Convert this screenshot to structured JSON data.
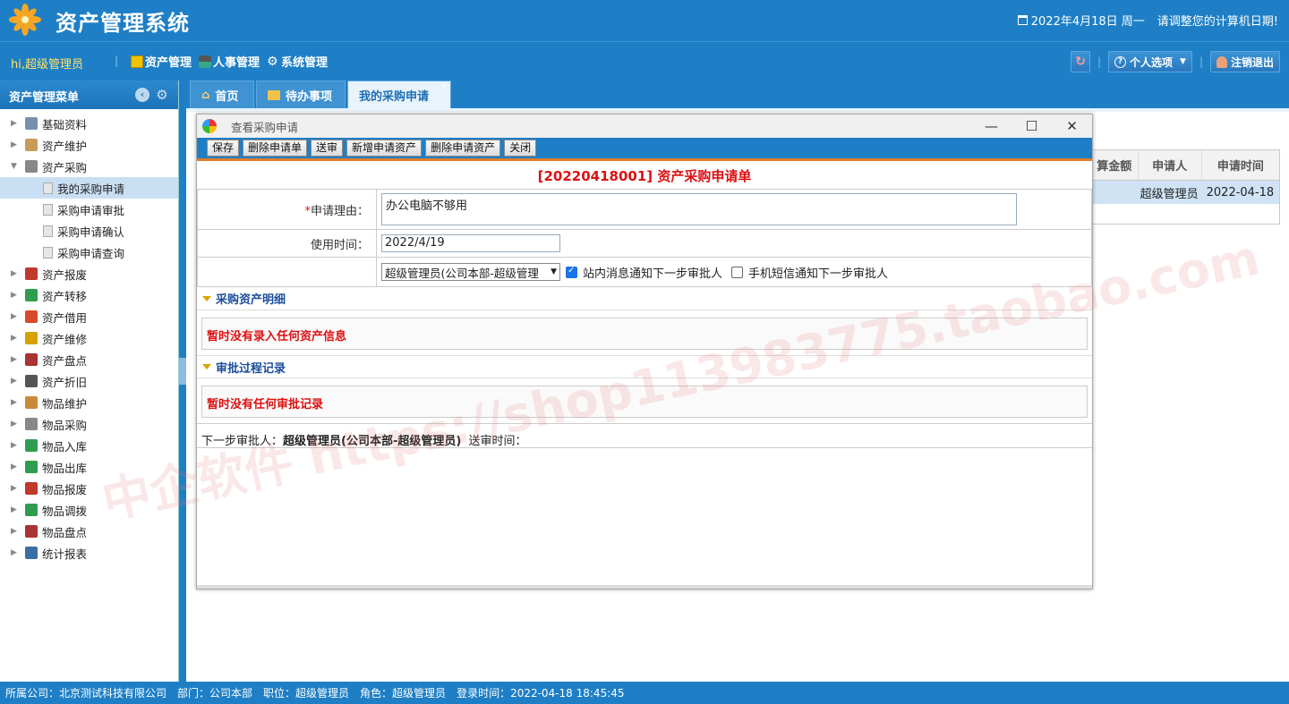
{
  "header": {
    "title": "资产管理系统",
    "date_text": "2022年4月18日 周一",
    "date_notice": "请调整您的计算机日期!"
  },
  "menubar": {
    "greeting": "hi,超级管理员",
    "items": [
      {
        "label": "资产管理",
        "icon": "notebook-icon"
      },
      {
        "label": "人事管理",
        "icon": "people-icon"
      },
      {
        "label": "系统管理",
        "icon": "gear-icon"
      }
    ],
    "personal_options": "个人选项",
    "logout": "注销退出"
  },
  "sidebar": {
    "title": "资产管理菜单",
    "items": [
      {
        "label": "基础资料",
        "color": "#7a8fb0",
        "expanded": false
      },
      {
        "label": "资产维护",
        "color": "#c79b5a",
        "expanded": false
      },
      {
        "label": "资产采购",
        "color": "#888888",
        "expanded": true
      },
      {
        "label": "我的采购申请",
        "child": true,
        "selected": true
      },
      {
        "label": "采购申请审批",
        "child": true
      },
      {
        "label": "采购申请确认",
        "child": true
      },
      {
        "label": "采购申请查询",
        "child": true
      },
      {
        "label": "资产报废",
        "color": "#c0392b"
      },
      {
        "label": "资产转移",
        "color": "#2e9d4f"
      },
      {
        "label": "资产借用",
        "color": "#d84a2a"
      },
      {
        "label": "资产维修",
        "color": "#d8a000"
      },
      {
        "label": "资产盘点",
        "color": "#aa3333"
      },
      {
        "label": "资产折旧",
        "color": "#555555"
      },
      {
        "label": "物品维护",
        "color": "#c98a3a"
      },
      {
        "label": "物品采购",
        "color": "#888888"
      },
      {
        "label": "物品入库",
        "color": "#2e9d4f"
      },
      {
        "label": "物品出库",
        "color": "#2e9d4f"
      },
      {
        "label": "物品报废",
        "color": "#c0392b"
      },
      {
        "label": "物品调拨",
        "color": "#2e9d4f"
      },
      {
        "label": "物品盘点",
        "color": "#aa3333"
      },
      {
        "label": "统计报表",
        "color": "#3a6ea5"
      }
    ]
  },
  "tabs": [
    {
      "label": "首页",
      "icon": "home-icon"
    },
    {
      "label": "待办事项",
      "icon": "folder-icon"
    },
    {
      "label": "我的采购申请",
      "active": true
    }
  ],
  "bg_grid": {
    "headers": [
      "算金额",
      "申请人",
      "申请时间"
    ],
    "row": [
      "",
      "超级管理员",
      "2022-04-18"
    ]
  },
  "dialog": {
    "title": "查看采购申请",
    "toolbar": [
      "保存",
      "删除申请单",
      "送审",
      "新增申请资产",
      "删除申请资产",
      "关闭"
    ],
    "form_title": "[20220418001] 资产采购申请单",
    "reason_label": "申请理由：",
    "reason_value": "办公电脑不够用",
    "use_time_label": "使用时间：",
    "use_time_value": "2022/4/19",
    "approver_select": "超级管理员(公司本部-超级管理",
    "notify_site": "站内消息通知下一步审批人",
    "notify_sms": "手机短信通知下一步审批人",
    "section_assets": "采购资产明细",
    "assets_empty": "暂时没有录入任何资产信息",
    "section_approval": "审批过程记录",
    "approval_empty": "暂时没有任何审批记录",
    "next_label": "下一步审批人：",
    "next_value": "超级管理员(公司本部-超级管理员)",
    "send_time_label": "送审时间："
  },
  "watermark": "中企软件 https://shop113983775.taobao.com",
  "statusbar": {
    "company": "所属公司：北京测试科技有限公司",
    "dept": "部门：公司本部",
    "position": "职位：超级管理员",
    "role": "角色：超级管理员",
    "login": "登录时间：2022-04-18 18:45:45"
  }
}
